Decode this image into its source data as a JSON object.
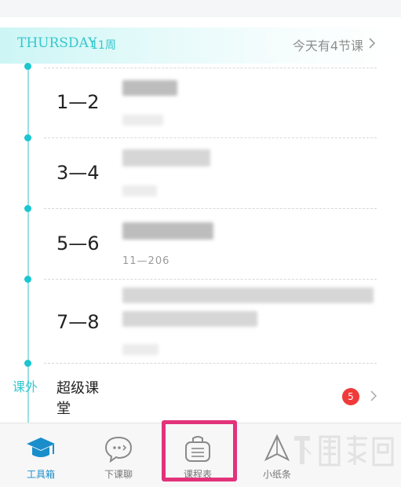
{
  "header": {
    "day": "THURSDAY",
    "week": "11周",
    "today_summary": "今天有4节课"
  },
  "schedule": [
    {
      "period": "1—2"
    },
    {
      "period": "3—4"
    },
    {
      "period": "5—6",
      "room": "11—206"
    },
    {
      "period": "7—8"
    }
  ],
  "extra": {
    "label": "课外",
    "title": "超级课堂",
    "badge_count": "5"
  },
  "tabs": [
    {
      "label": "工具箱",
      "icon": "graduation-cap-icon"
    },
    {
      "label": "下课聊",
      "icon": "chat-bubble-icon"
    },
    {
      "label": "课程表",
      "icon": "schedule-bag-icon"
    },
    {
      "label": "小纸条",
      "icon": "paper-plane-icon"
    }
  ],
  "colors": {
    "accent": "#35c7cd",
    "active_tab": "#1a8ecb",
    "badge": "#f03a3a",
    "highlight": "#e2337a"
  }
}
